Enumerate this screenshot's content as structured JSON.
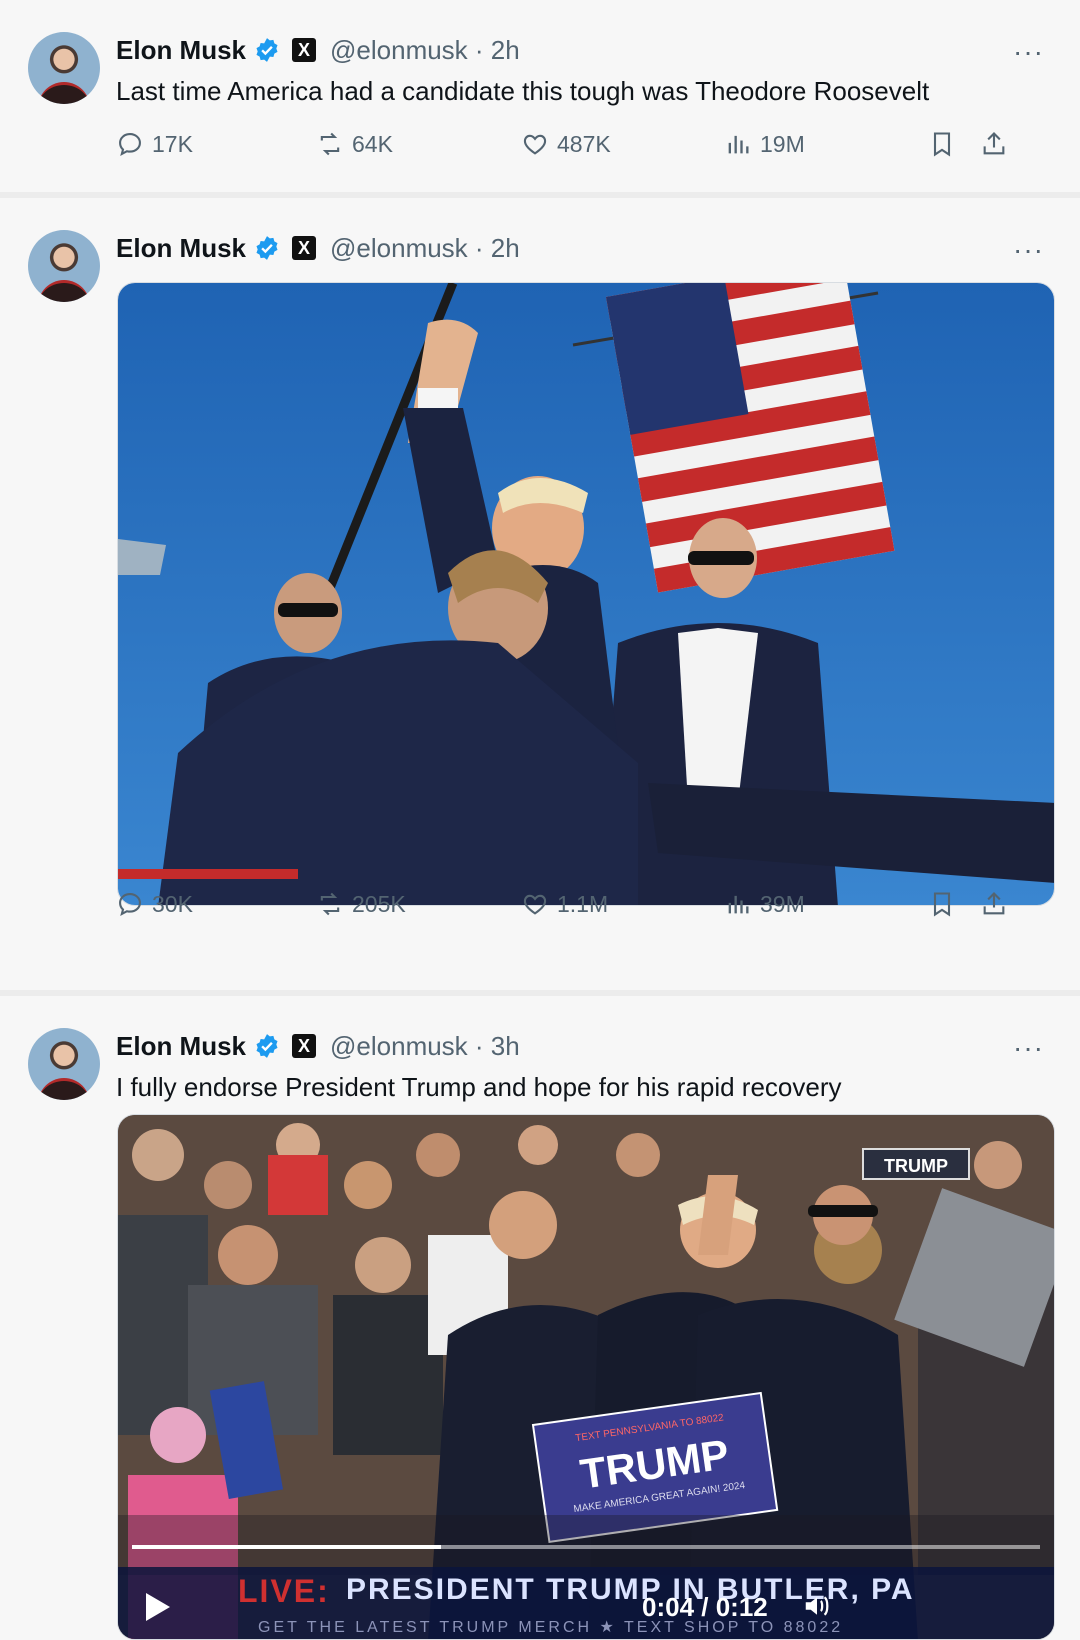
{
  "tweets": [
    {
      "name": "Elon Musk",
      "handle": "@elonmusk · 2h",
      "text": "Last time America had a candidate this tough was Theodore Roosevelt",
      "replies": "17K",
      "reposts": "64K",
      "likes": "487K",
      "views": "19M"
    },
    {
      "name": "Elon Musk",
      "handle": "@elonmusk · 2h",
      "text": "",
      "replies": "30K",
      "reposts": "205K",
      "likes": "1.1M",
      "views": "39M"
    },
    {
      "name": "Elon Musk",
      "handle": "@elonmusk · 3h",
      "text": "I fully endorse President Trump and hope for his rapid recovery"
    }
  ],
  "x_badge": "X",
  "more": "···",
  "video": {
    "live": "LIVE:",
    "headline": "PRESIDENT TRUMP IN BUTLER, PA",
    "sub": "GET THE LATEST TRUMP MERCH  ★  TEXT SHOP TO 88022",
    "time": "0:04 / 0:12",
    "sign_small": "TEXT PENNSYLVANIA TO 88022",
    "sign_main": "TRUMP",
    "sign_tag": "MAKE AMERICA GREAT AGAIN! 2024",
    "corner_sign": "TRUMP",
    "progress": 0.34
  },
  "colors": {
    "verified": "#1d9bf0",
    "sky": "#2a6fbf",
    "navy": "#1a2340",
    "red": "#c42b2b"
  },
  "icons": [
    "reply-icon",
    "repost-icon",
    "like-icon",
    "views-icon",
    "bookmark-icon",
    "share-icon",
    "verified-icon",
    "play-icon",
    "volume-icon"
  ]
}
